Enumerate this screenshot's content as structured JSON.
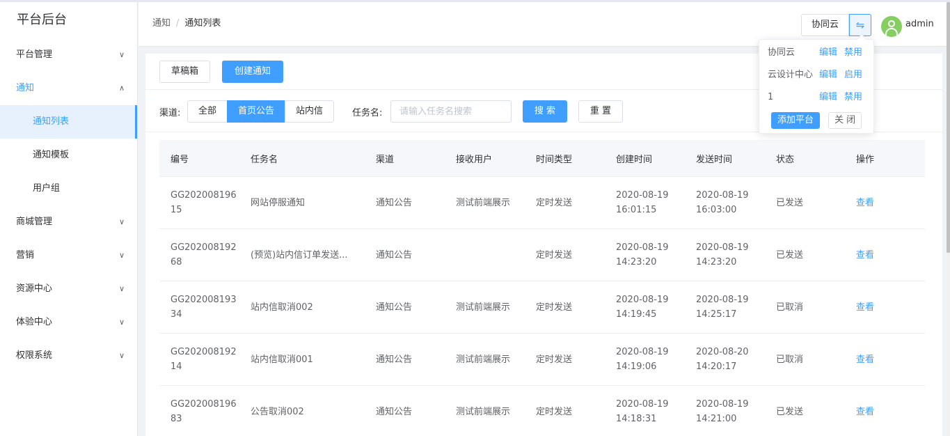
{
  "sidebar": {
    "brand": "平台后台",
    "items": [
      {
        "label": "平台管理"
      },
      {
        "label": "通知"
      },
      {
        "label": "通知列表"
      },
      {
        "label": "通知模板"
      },
      {
        "label": "用户组"
      },
      {
        "label": "商城管理"
      },
      {
        "label": "营销"
      },
      {
        "label": "资源中心"
      },
      {
        "label": "体验中心"
      },
      {
        "label": "权限系统"
      }
    ]
  },
  "header": {
    "breadcrumb": [
      "通知",
      "/",
      "通知列表"
    ],
    "platform": "协同云",
    "switch_icon": "⇋",
    "username": "admin"
  },
  "toolbar": {
    "drafts": "草稿箱",
    "create": "创建通知"
  },
  "filter": {
    "channel_label": "渠道:",
    "channels": [
      "全部",
      "首页公告",
      "站内信"
    ],
    "task_label": "任务名:",
    "task_placeholder": "请输入任务名搜索",
    "search": "搜 索",
    "reset": "重 置"
  },
  "table": {
    "headers": [
      "编号",
      "任务名",
      "渠道",
      "接收用户",
      "时间类型",
      "创建时间",
      "发送时间",
      "状态",
      "操作"
    ],
    "rows": [
      {
        "id": "GG20200819615",
        "name": "网站停服通知",
        "channel": "通知公告",
        "user": "测试前端展示",
        "type": "定时发送",
        "created": "2020-08-19 16:01:15",
        "sent": "2020-08-19 16:03:00",
        "status": "已发送",
        "op": "查看"
      },
      {
        "id": "GG20200819268",
        "name": "(预览)站内信订单发送...",
        "channel": "通知公告",
        "user": "",
        "type": "定时发送",
        "created": "2020-08-19 14:23:20",
        "sent": "2020-08-19 14:23:20",
        "status": "已发送",
        "op": "查看"
      },
      {
        "id": "GG20200819334",
        "name": "站内信取消002",
        "channel": "通知公告",
        "user": "测试前端展示",
        "type": "定时发送",
        "created": "2020-08-19 14:19:45",
        "sent": "2020-08-19 14:25:17",
        "status": "已取消",
        "op": "查看"
      },
      {
        "id": "GG20200819214",
        "name": "站内信取消001",
        "channel": "通知公告",
        "user": "测试前端展示",
        "type": "定时发送",
        "created": "2020-08-19 14:19:06",
        "sent": "2020-08-20 14:20:17",
        "status": "已取消",
        "op": "查看"
      },
      {
        "id": "GG20200819683",
        "name": "公告取消002",
        "channel": "通知公告",
        "user": "测试前端展示",
        "type": "定时发送",
        "created": "2020-08-19 14:18:31",
        "sent": "2020-08-19 14:21:00",
        "status": "已发送",
        "op": "查看"
      }
    ]
  },
  "popover": {
    "rows": [
      {
        "name": "协同云",
        "edit": "编辑",
        "action": "禁用"
      },
      {
        "name": "云设计中心",
        "edit": "编辑",
        "action": "启用"
      },
      {
        "name": "1",
        "edit": "编辑",
        "action": "禁用"
      }
    ],
    "add": "添加平台",
    "close": "关 闭"
  }
}
